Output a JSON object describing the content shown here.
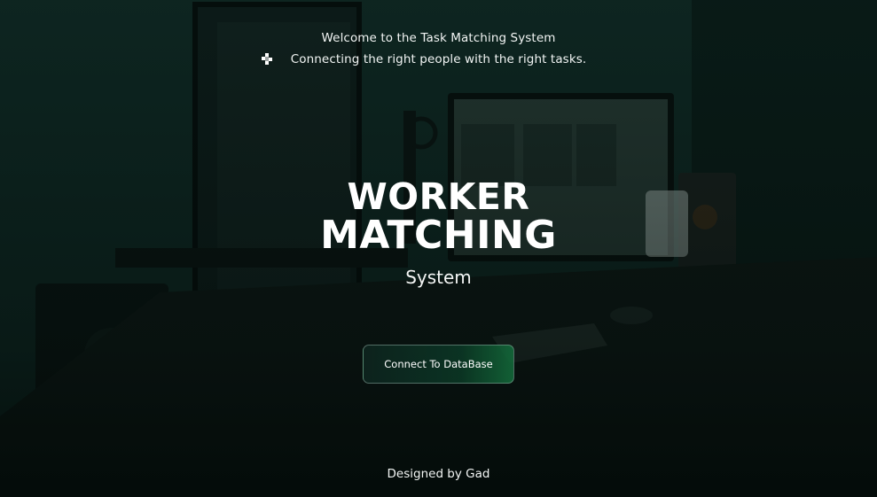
{
  "header": {
    "welcome_text": "Welcome to the Task Matching System",
    "tagline_text": "Connecting the right people with the right tasks.",
    "tagline_icon": "diamond-dots-icon"
  },
  "hero": {
    "title_line1": "WORKER",
    "title_line2": "MATCHING",
    "subtitle": "System"
  },
  "actions": {
    "connect_label": "Connect To DataBase"
  },
  "footer": {
    "credit": "Designed by Gad"
  },
  "colors": {
    "background": "#0d1e1b",
    "button_accent": "#146e3c",
    "text": "#ffffff"
  }
}
